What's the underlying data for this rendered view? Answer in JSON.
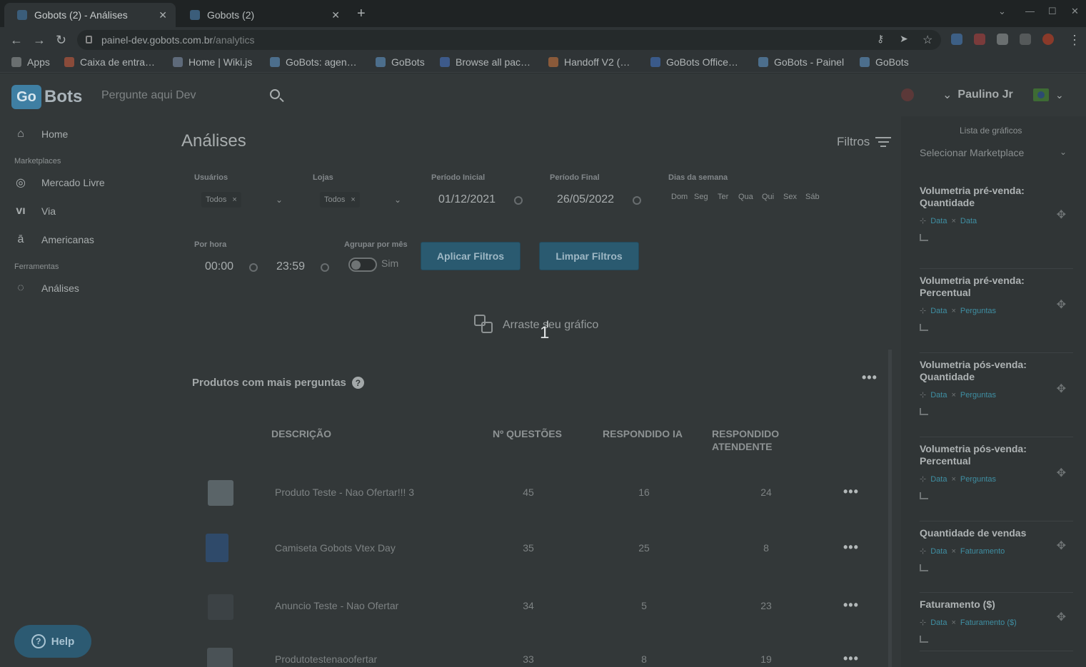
{
  "browser": {
    "tabs": [
      {
        "label": "Gobots (2) - Análises",
        "active": true
      },
      {
        "label": "Gobots (2)",
        "active": false
      }
    ],
    "url_domain": "painel-dev.gobots.com.br",
    "url_path": "/analytics",
    "bookmarks": [
      "Apps",
      "Caixa de entra…",
      "Home | Wiki.js",
      "GoBots: agen…",
      "GoBots",
      "Browse all pac…",
      "Handoff V2 (…",
      "GoBots Office…",
      "GoBots - Painel",
      "GoBots"
    ]
  },
  "header": {
    "logo_go": "Go",
    "logo_bots": "Bots",
    "search_placeholder": "Pergunte aqui Dev",
    "user_name": "Paulino Jr"
  },
  "sidebar": {
    "home": "Home",
    "section_marketplaces": "Marketplaces",
    "marketplaces": [
      "Mercado Livre",
      "Via",
      "Americanas"
    ],
    "section_tools": "Ferramentas",
    "tools": [
      "Análises"
    ],
    "help": "Help"
  },
  "main": {
    "title": "Análises",
    "filters_label": "Filtros",
    "filters": {
      "usuarios_label": "Usuários",
      "usuarios_value": "Todos",
      "lojas_label": "Lojas",
      "lojas_value": "Todos",
      "periodo_inicial_label": "Período Inicial",
      "periodo_inicial": "01/12/2021",
      "periodo_final_label": "Período Final",
      "periodo_final": "26/05/2022",
      "dias_label": "Dias da semana",
      "dias": [
        "Dom",
        "Seg",
        "Ter",
        "Qua",
        "Qui",
        "Sex",
        "Sáb"
      ],
      "por_hora_label": "Por hora",
      "hora_inicio": "00:00",
      "hora_fim": "23:59",
      "agrupar_label": "Agrupar por mês",
      "agrupar_value": "Sim",
      "apply_button": "Aplicar Filtros",
      "clear_button": "Limpar Filtros"
    },
    "dropzone_text": "Arraste seu gráfico",
    "drag_badge": "1",
    "card": {
      "title": "Produtos com mais perguntas",
      "columns": [
        "DESCRIÇÃO",
        "Nº QUESTÕES",
        "RESPONDIDO IA",
        "RESPONDIDO ATENDENTE"
      ],
      "rows": [
        {
          "desc": "Produto Teste - Nao Ofertar!!! 3",
          "questoes": "45",
          "ia": "16",
          "atendente": "24"
        },
        {
          "desc": "Camiseta Gobots Vtex Day",
          "questoes": "35",
          "ia": "25",
          "atendente": "8"
        },
        {
          "desc": "Anuncio Teste - Nao Ofertar",
          "questoes": "34",
          "ia": "5",
          "atendente": "23"
        },
        {
          "desc": "Produtotestenaoofertar",
          "questoes": "33",
          "ia": "8",
          "atendente": "19"
        }
      ]
    }
  },
  "right_panel": {
    "header": "Lista de gráficos",
    "select_placeholder": "Selecionar Marketplace",
    "charts": [
      {
        "title": "Volumetria pré-venda: Quantidade",
        "tag1": "Data",
        "tag2": "Data"
      },
      {
        "title": "Volumetria pré-venda: Percentual",
        "tag1": "Data",
        "tag2": "Perguntas"
      },
      {
        "title": "Volumetria pós-venda: Quantidade",
        "tag1": "Data",
        "tag2": "Perguntas"
      },
      {
        "title": "Volumetria pós-venda: Percentual",
        "tag1": "Data",
        "tag2": "Perguntas"
      },
      {
        "title": "Quantidade de vendas",
        "tag1": "Data",
        "tag2": "Faturamento"
      },
      {
        "title": "Faturamento ($)",
        "tag1": "Data",
        "tag2": "Faturamento ($)"
      }
    ]
  }
}
